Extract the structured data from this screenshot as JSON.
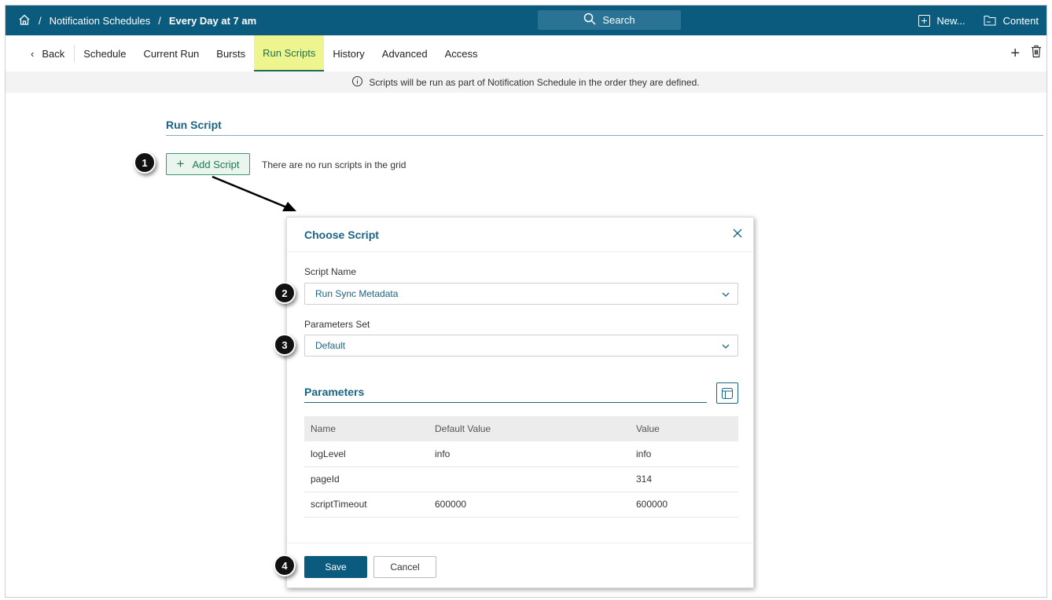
{
  "header": {
    "breadcrumb": [
      "Notification Schedules",
      "Every Day at 7 am"
    ],
    "separator": "/",
    "search_label": "Search",
    "new_label": "New...",
    "content_label": "Content"
  },
  "nav": {
    "back": "Back",
    "tabs": [
      "Schedule",
      "Current Run",
      "Bursts",
      "Run Scripts",
      "History",
      "Advanced",
      "Access"
    ],
    "active": "Run Scripts"
  },
  "info": "Scripts will be run as part of Notification Schedule in the order they are defined.",
  "section": {
    "title": "Run Script",
    "add_label": "Add Script",
    "empty_text": "There are no run scripts in the grid"
  },
  "modal": {
    "title": "Choose Script",
    "script_name_label": "Script Name",
    "script_name_value": "Run Sync Metadata",
    "params_set_label": "Parameters Set",
    "params_set_value": "Default",
    "parameters_title": "Parameters",
    "columns": [
      "Name",
      "Default Value",
      "Value"
    ],
    "rows": [
      [
        "logLevel",
        "info",
        "info"
      ],
      [
        "pageId",
        "",
        "314"
      ],
      [
        "scriptTimeout",
        "600000",
        "600000"
      ]
    ],
    "save": "Save",
    "cancel": "Cancel"
  },
  "annotations": [
    "1",
    "2",
    "3",
    "4"
  ],
  "colors": {
    "brand": "#0b5b7e",
    "accent_green": "#1e7a4e",
    "active_tab": "#eef58f"
  }
}
